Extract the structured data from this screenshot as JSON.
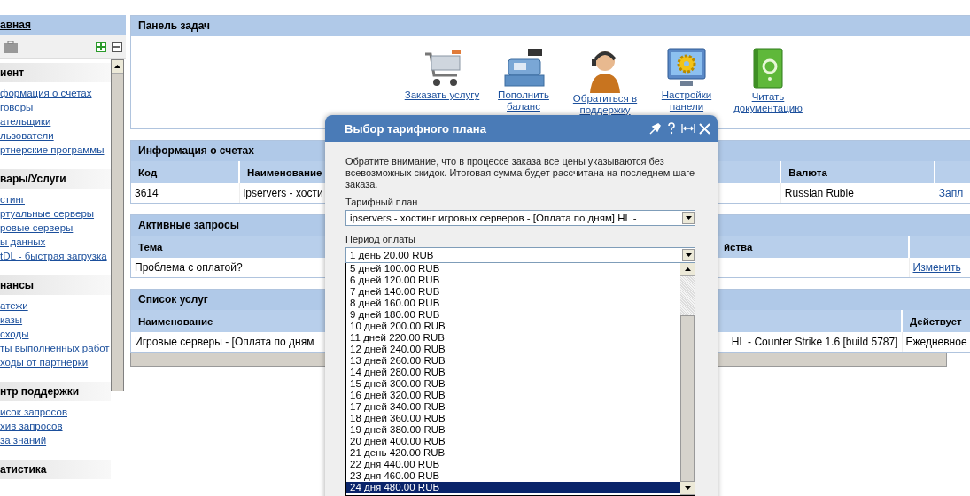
{
  "sidebar": {
    "title": "авная",
    "sections": [
      {
        "title": "иент",
        "links": [
          "формация о счетах",
          "говоры",
          "ательщики",
          "льзователи",
          "ртнерские программы"
        ]
      },
      {
        "title": "вары/Услуги",
        "links": [
          "стинг",
          "ртуальные серверы",
          "ровые серверы",
          "ы данных",
          "tDL - быстрая загрузка"
        ]
      },
      {
        "title": "нансы",
        "links": [
          "атежи",
          "казы",
          "сходы",
          "ты выполненных работ",
          "ходы от партнерки"
        ]
      },
      {
        "title": "нтр поддержки",
        "links": [
          "исок запросов",
          "хив запросов",
          "за знаний"
        ]
      },
      {
        "title": "атистика"
      }
    ]
  },
  "task_panel": {
    "title": "Панель задач",
    "actions": [
      {
        "kind": "cart",
        "label": "Заказать услугу"
      },
      {
        "kind": "register",
        "label": "Пополнить баланс"
      },
      {
        "kind": "support",
        "label": "Обратиться в поддержку"
      },
      {
        "kind": "settings",
        "label": "Настройки панели"
      },
      {
        "kind": "help",
        "label": "Читать документацию"
      }
    ]
  },
  "tables": [
    {
      "title": "Информация о счетах",
      "columns": [
        "Код",
        "Наименование",
        "Валюта",
        null
      ],
      "rows": [
        [
          {
            "text": "3614",
            "link": false
          },
          {
            "text": "ipservers - хости",
            "link": false
          },
          {
            "text": "Russian Ruble",
            "link": false
          },
          {
            "text": "Запл",
            "link": true
          }
        ]
      ]
    },
    {
      "title": "Активные запросы",
      "columns": [
        "Тема",
        "йства",
        null
      ],
      "rows": [
        [
          {
            "text": "Проблема с оплатой?",
            "link": false
          },
          null,
          {
            "text": "Изменить",
            "link": true
          }
        ]
      ]
    },
    {
      "title": "Список услуг",
      "columns": [
        "Наименование",
        null,
        "Действует"
      ],
      "rows": [
        [
          {
            "text": "Игровые серверы - [Оплата по дням",
            "link": false
          },
          {
            "text": "HL - Counter Strike 1.6 [build 5787]",
            "link": false
          },
          {
            "text": "Ежедневное",
            "link": false
          }
        ]
      ]
    }
  ],
  "dialog": {
    "title": "Выбор тарифного плана",
    "notice": "Обратите внимание, что в процессе заказа все цены указываются без всевозможных скидок. Итоговая сумма будет рассчитана на последнем шаге заказа.",
    "plan": {
      "label": "Тарифный план",
      "value": "ipservers - хостинг игровых серверов - [Оплата по дням] HL -"
    },
    "period": {
      "label": "Период оплаты",
      "value": "1 день 20.00 RUB",
      "options": [
        {
          "label": "5 дней 100.00 RUB",
          "selected": false
        },
        {
          "label": "6 дней 120.00 RUB",
          "selected": false
        },
        {
          "label": "7 дней 140.00 RUB",
          "selected": false
        },
        {
          "label": "8 дней 160.00 RUB",
          "selected": false
        },
        {
          "label": "9 дней 180.00 RUB",
          "selected": false
        },
        {
          "label": "10 дней 200.00 RUB",
          "selected": false
        },
        {
          "label": "11 дней 220.00 RUB",
          "selected": false
        },
        {
          "label": "12 дней 240.00 RUB",
          "selected": false
        },
        {
          "label": "13 дней 260.00 RUB",
          "selected": false
        },
        {
          "label": "14 дней 280.00 RUB",
          "selected": false
        },
        {
          "label": "15 дней 300.00 RUB",
          "selected": false
        },
        {
          "label": "16 дней 320.00 RUB",
          "selected": false
        },
        {
          "label": "17 дней 340.00 RUB",
          "selected": false
        },
        {
          "label": "18 дней 360.00 RUB",
          "selected": false
        },
        {
          "label": "19 дней 380.00 RUB",
          "selected": false
        },
        {
          "label": "20 дней 400.00 RUB",
          "selected": false
        },
        {
          "label": "21 день 420.00 RUB",
          "selected": false
        },
        {
          "label": "22 дня 440.00 RUB",
          "selected": false
        },
        {
          "label": "23 дня 460.00 RUB",
          "selected": false
        },
        {
          "label": "24 дня 480.00 RUB",
          "selected": true
        }
      ]
    }
  }
}
